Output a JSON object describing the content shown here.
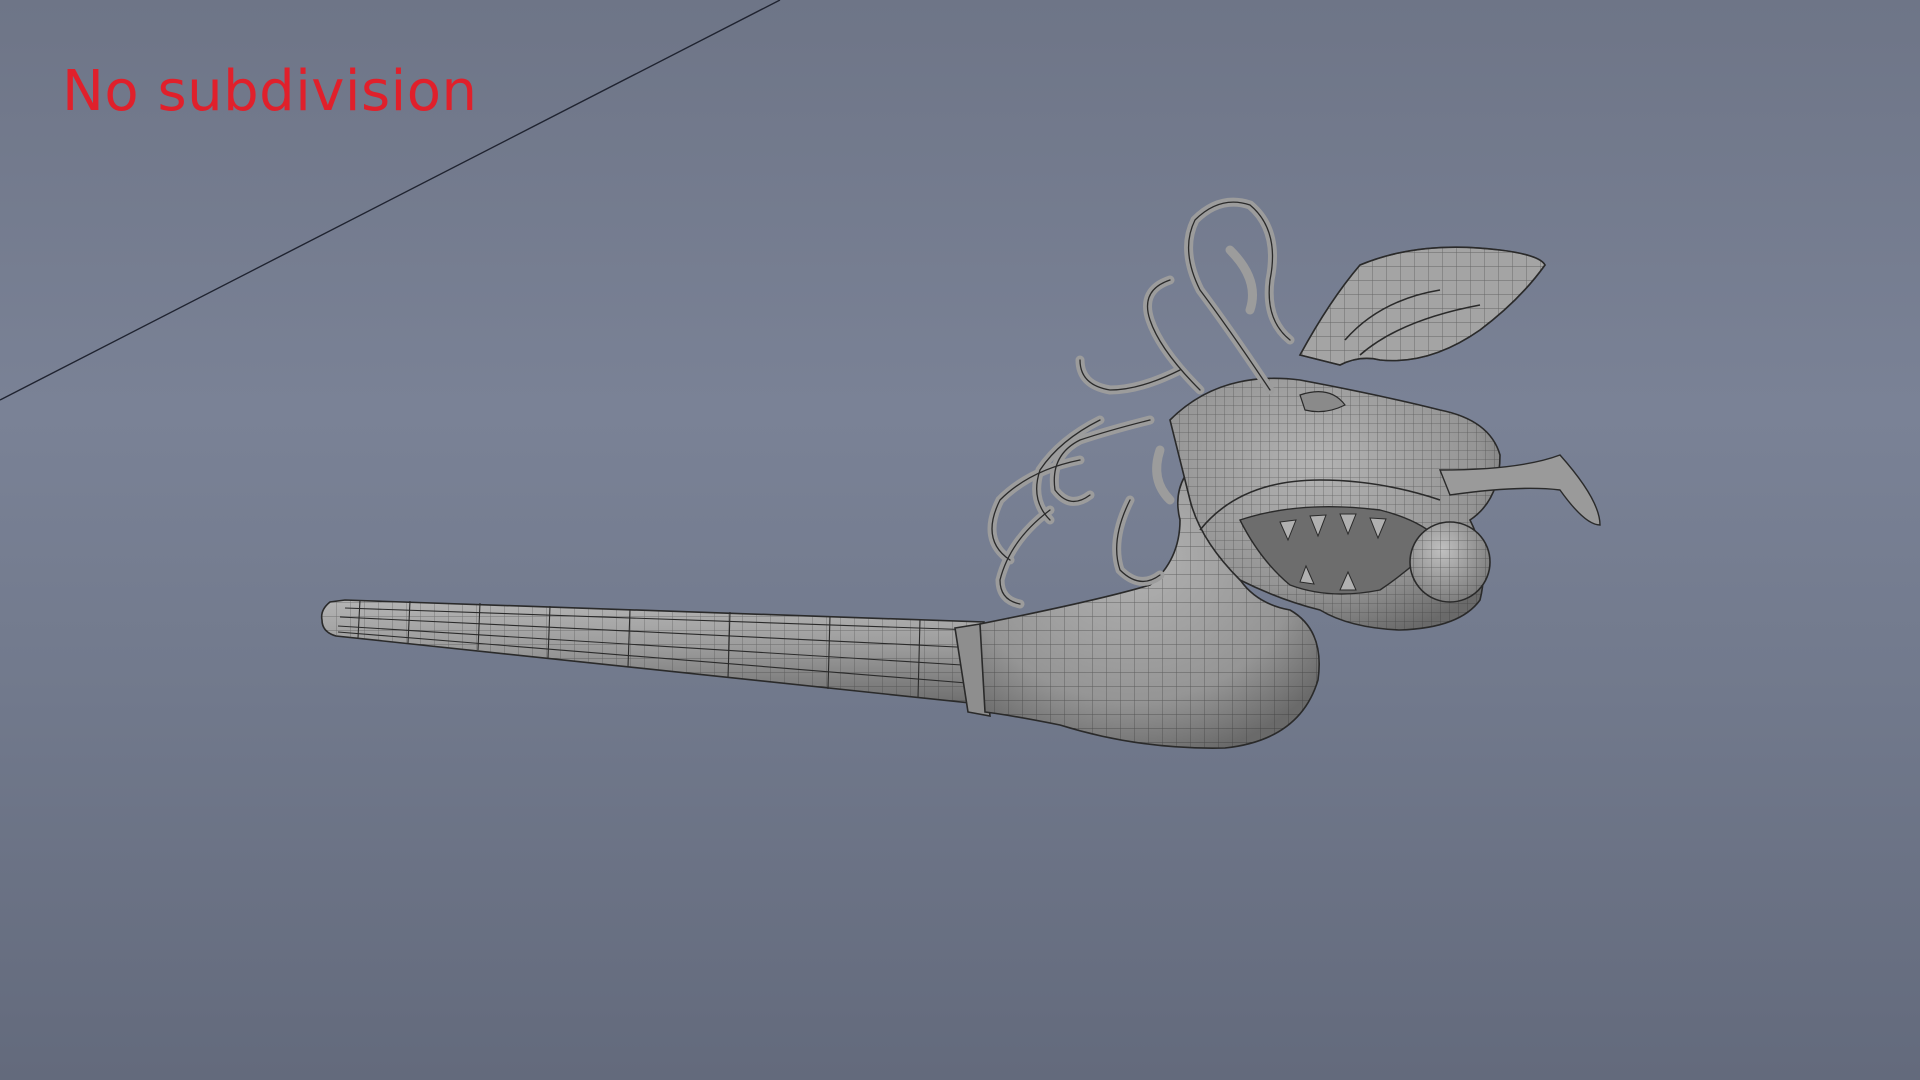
{
  "viewport": {
    "overlay_label": "No subdivision",
    "label_color": "#e0202b",
    "background_color": "#727a8d",
    "model": {
      "name": "dragon-head-pipe",
      "display_mode": "wireframe-on-shaded",
      "mesh_color": "#9a9a9a",
      "wire_color": "#2a2a2a"
    }
  }
}
